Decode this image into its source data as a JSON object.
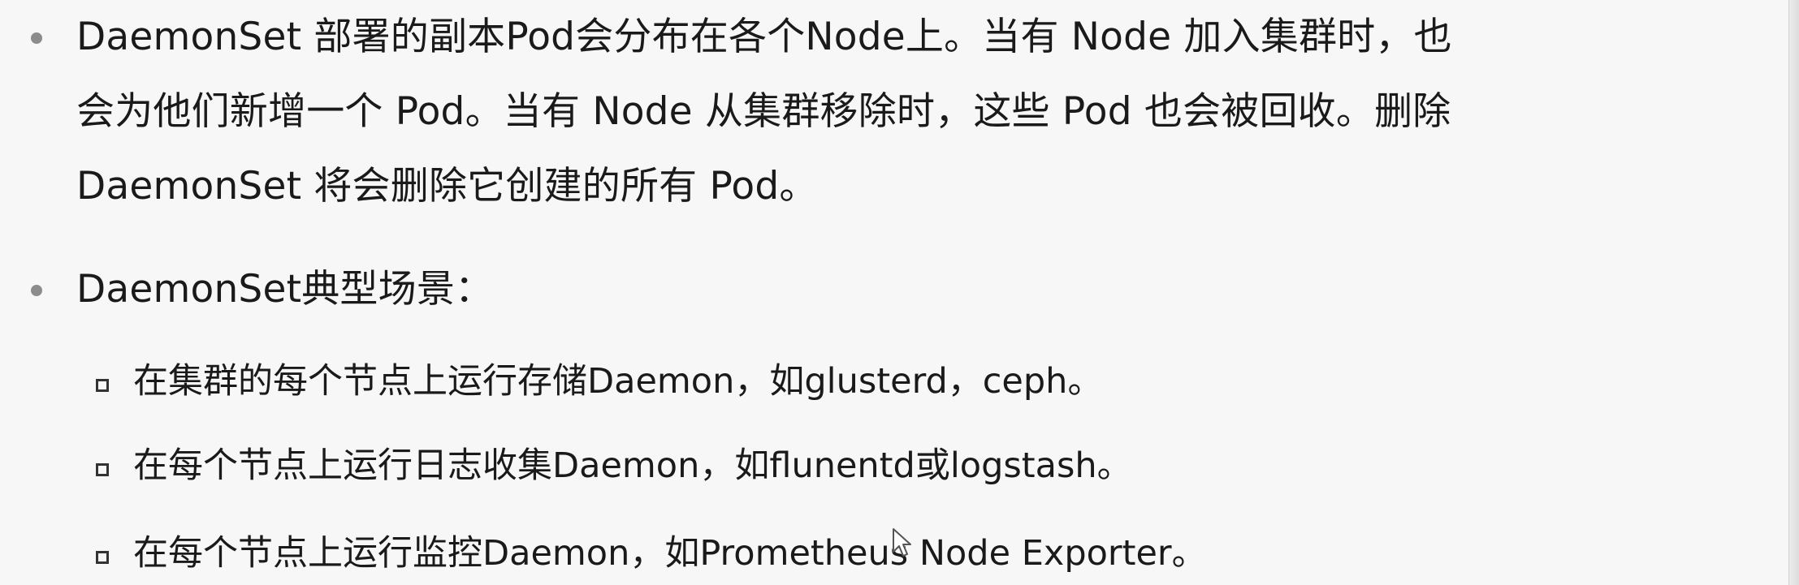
{
  "bullets": [
    {
      "lines": [
        "DaemonSet 部署的副本Pod会分布在各个Node上。当有 Node 加入集群时，也",
        "会为他们新增一个 Pod。当有 Node 从集群移除时，这些 Pod 也会被回收。删除",
        "DaemonSet 将会删除它创建的所有 Pod。"
      ]
    },
    {
      "text": "DaemonSet典型场景：",
      "sub_items": [
        "在集群的每个节点上运行存储Daemon，如glusterd，ceph。",
        "在每个节点上运行日志收集Daemon，如flunentd或logstash。",
        "在每个节点上运行监控Daemon，如Prometheus Node Exporter。"
      ]
    }
  ],
  "icons": {
    "bullet_level1": "gray-dot-icon",
    "bullet_level2": "hollow-square-icon",
    "cursor": "mouse-pointer-icon"
  },
  "colors": {
    "background": "#f7f7f7",
    "text": "#1a1a1a",
    "bullet_level1": "#8c8c8c"
  }
}
